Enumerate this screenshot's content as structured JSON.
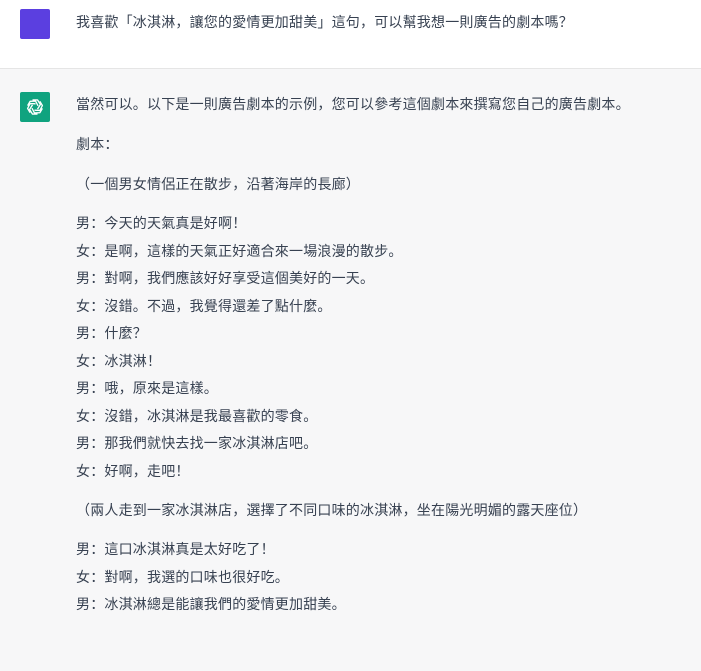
{
  "user_message": {
    "text": "我喜歡「冰淇淋，讓您的愛情更加甜美」這句，可以幫我想一則廣告的劇本嗎？"
  },
  "assistant_message": {
    "intro": "當然可以。以下是一則廣告劇本的示例，您可以參考這個劇本來撰寫您自己的廣告劇本。",
    "script_label": "劇本：",
    "scene1": "（一個男女情侶正在散步，沿著海岸的長廊）",
    "dialogue1": [
      "男：今天的天氣真是好啊！",
      "女：是啊，這樣的天氣正好適合來一場浪漫的散步。",
      "男：對啊，我們應該好好享受這個美好的一天。",
      "女：沒錯。不過，我覺得還差了點什麼。",
      "男：什麼？",
      "女：冰淇淋！",
      "男：哦，原來是這樣。",
      "女：沒錯，冰淇淋是我最喜歡的零食。",
      "男：那我們就快去找一家冰淇淋店吧。",
      "女：好啊，走吧！"
    ],
    "scene2": "（兩人走到一家冰淇淋店，選擇了不同口味的冰淇淋，坐在陽光明媚的露天座位）",
    "dialogue2": [
      "男：這口冰淇淋真是太好吃了！",
      "女：對啊，我選的口味也很好吃。",
      "男：冰淇淋總是能讓我們的愛情更加甜美。"
    ]
  },
  "colors": {
    "user_avatar": "#5b3fe0",
    "assistant_avatar": "#10a37f",
    "text": "#374151"
  }
}
